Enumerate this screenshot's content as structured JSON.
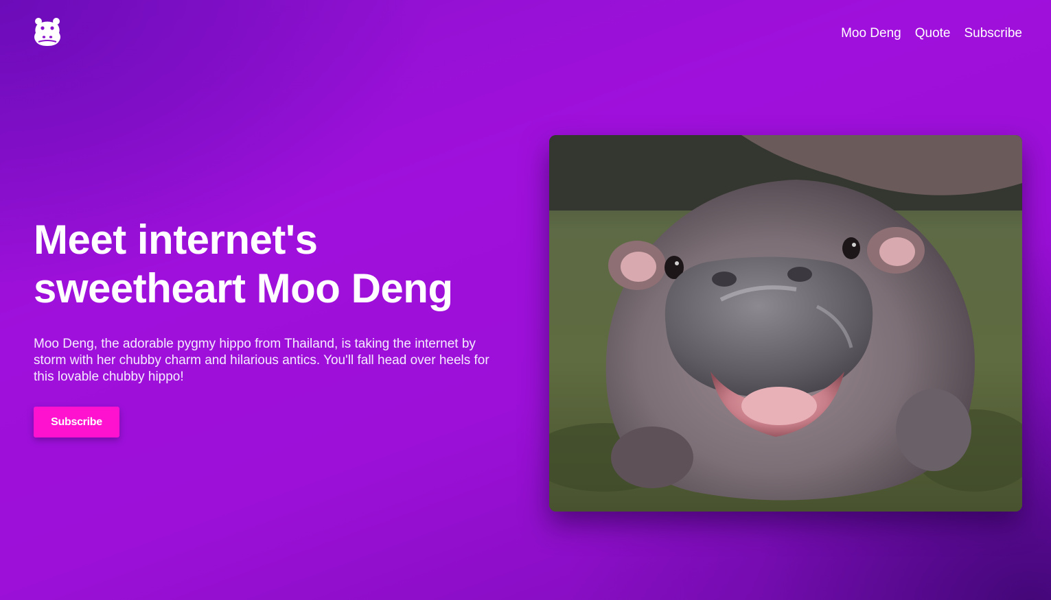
{
  "header": {
    "logo_icon": "hippo-face-icon",
    "nav": [
      {
        "label": "Moo Deng"
      },
      {
        "label": "Quote"
      },
      {
        "label": "Subscribe"
      }
    ]
  },
  "hero": {
    "title": "Meet internet's\nsweetheart Moo Deng",
    "description": "Moo Deng, the adorable pygmy hippo from Thailand, is taking the internet by storm with her chubby charm and hilarious antics. You'll fall head over heels for this lovable chubby hippo!",
    "cta_label": "Subscribe",
    "photo_alt": "Moo Deng the baby pygmy hippo with mouth open"
  },
  "colors": {
    "background_gradient": [
      "#8a12cc",
      "#a010dc",
      "#3a066e"
    ],
    "cta": "#ff11d0",
    "text": "#ffffff"
  }
}
